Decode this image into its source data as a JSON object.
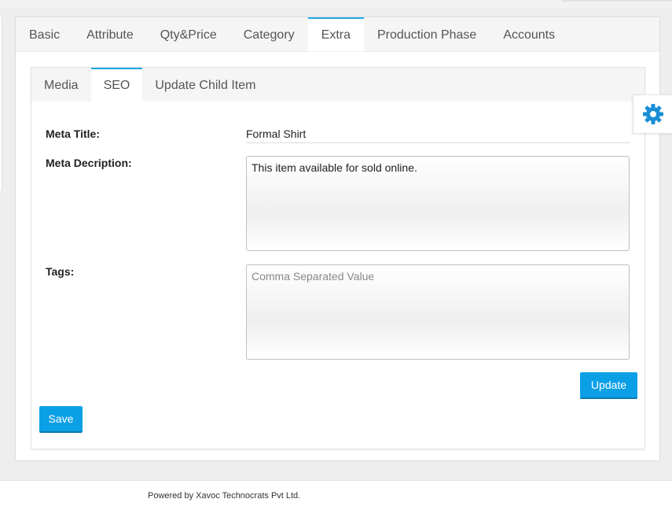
{
  "outer_tabs": [
    "Basic",
    "Attribute",
    "Qty&Price",
    "Category",
    "Extra",
    "Production Phase",
    "Accounts"
  ],
  "outer_active": "Extra",
  "inner_tabs": [
    "Media",
    "SEO",
    "Update Child Item"
  ],
  "inner_active": "SEO",
  "form": {
    "meta_title_label": "Meta Title:",
    "meta_title_value": "Formal Shirt",
    "meta_description_label": "Meta Decription:",
    "meta_description_value": "This item available for sold online.",
    "tags_label": "Tags:",
    "tags_value": "",
    "tags_placeholder": "Comma Separated Value"
  },
  "buttons": {
    "update": "Update",
    "save": "Save"
  },
  "settings_icon": "gear-icon",
  "footer": {
    "text": "Powered by Xavoc Technocrats Pvt Ltd."
  },
  "colors": {
    "accent": "#0ba0e6",
    "tab_active_border": "#1fa7e4"
  }
}
